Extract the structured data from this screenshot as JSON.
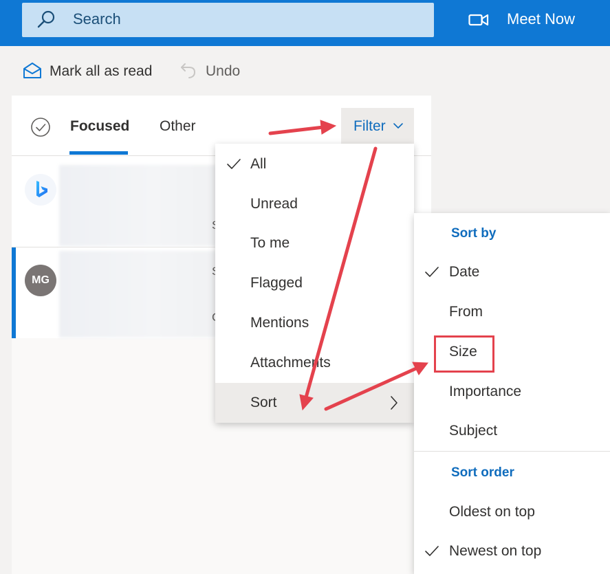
{
  "topbar": {
    "search_label": "Search",
    "meet_now_label": "Meet Now",
    "brand_color": "#0f78d4"
  },
  "command_bar": {
    "mark_all_read_label": "Mark all as read",
    "undo_label": "Undo"
  },
  "message_list": {
    "tabs": [
      {
        "label": "Focused",
        "selected": true
      },
      {
        "label": "Other",
        "selected": false
      }
    ],
    "filter_label": "Filter",
    "messages": [
      {
        "avatar": "bing-logo",
        "peek_text": "S"
      },
      {
        "avatar_initials": "MG",
        "peek_text": "S",
        "peek_text_2": "C"
      }
    ]
  },
  "filter_menu": {
    "items": [
      {
        "label": "All",
        "checked": true
      },
      {
        "label": "Unread",
        "checked": false
      },
      {
        "label": "To me",
        "checked": false
      },
      {
        "label": "Flagged",
        "checked": false
      },
      {
        "label": "Mentions",
        "checked": false
      },
      {
        "label": "Attachments",
        "checked": false
      },
      {
        "label": "Sort",
        "checked": false,
        "has_submenu": true,
        "highlighted": true
      }
    ]
  },
  "sort_menu": {
    "sort_by_header": "Sort by",
    "sort_by_items": [
      {
        "label": "Date",
        "checked": true
      },
      {
        "label": "From",
        "checked": false
      },
      {
        "label": "Size",
        "checked": false,
        "annotated": true
      },
      {
        "label": "Importance",
        "checked": false
      },
      {
        "label": "Subject",
        "checked": false
      }
    ],
    "sort_order_header": "Sort order",
    "sort_order_items": [
      {
        "label": "Oldest on top",
        "checked": false
      },
      {
        "label": "Newest on top",
        "checked": true
      }
    ]
  },
  "annotation": {
    "color": "#e4424d"
  }
}
